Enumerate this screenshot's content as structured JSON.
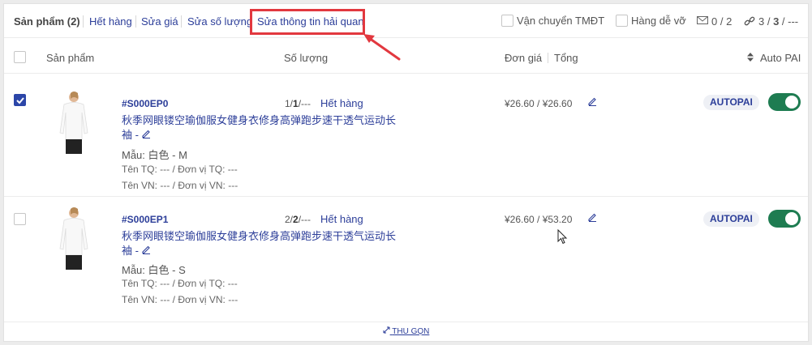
{
  "toolbar": {
    "title": "Sản phẩm (2)",
    "links": [
      "Hết hàng",
      "Sửa giá",
      "Sửa số lượng",
      "Sửa thông tin hải quan"
    ],
    "option_ecommerce": "Vận chuyển TMĐT",
    "option_fragile": "Hàng dễ vỡ",
    "message_count": "0 / 2",
    "link_count_a": "3 / ",
    "link_count_b": "3",
    "link_count_c": " / ---"
  },
  "table": {
    "headers": {
      "product": "Sản phẩm",
      "quantity": "Số lượng",
      "unit_price": "Đơn giá",
      "total": "Tổng",
      "autopai": "Auto PAI"
    }
  },
  "rows": [
    {
      "checked": true,
      "code": "#S000EP0",
      "qty_a": "1/",
      "qty_b": "1",
      "qty_c": "/---",
      "status": "Hết hàng",
      "name": "秋季网眼镂空瑜伽服女健身衣修身高弹跑步速干透气运动长袖 -",
      "variant": "Mẫu: 白色 - M",
      "cn_name": "Tên TQ: ---  /  Đơn vị TQ: ---",
      "vn_name": "Tên VN: ---  /  Đơn vị VN: ---",
      "price": "¥26.60 / ¥26.60",
      "badge": "AUTOPAI"
    },
    {
      "checked": false,
      "code": "#S000EP1",
      "qty_a": "2/",
      "qty_b": "2",
      "qty_c": "/---",
      "status": "Hết hàng",
      "name": "秋季网眼镂空瑜伽服女健身衣修身高弹跑步速干透气运动长袖 -",
      "variant": "Mẫu: 白色 - S",
      "cn_name": "Tên TQ: ---  /  Đơn vị TQ: ---",
      "vn_name": "Tên VN: ---  /  Đơn vị VN: ---",
      "price": "¥26.60 / ¥53.20",
      "badge": "AUTOPAI"
    }
  ],
  "footer": {
    "collapse_label": "THU GỌN"
  },
  "colors": {
    "accent": "#2c3e99",
    "highlight": "#e2383f",
    "toggle_on": "#1e7c51"
  }
}
